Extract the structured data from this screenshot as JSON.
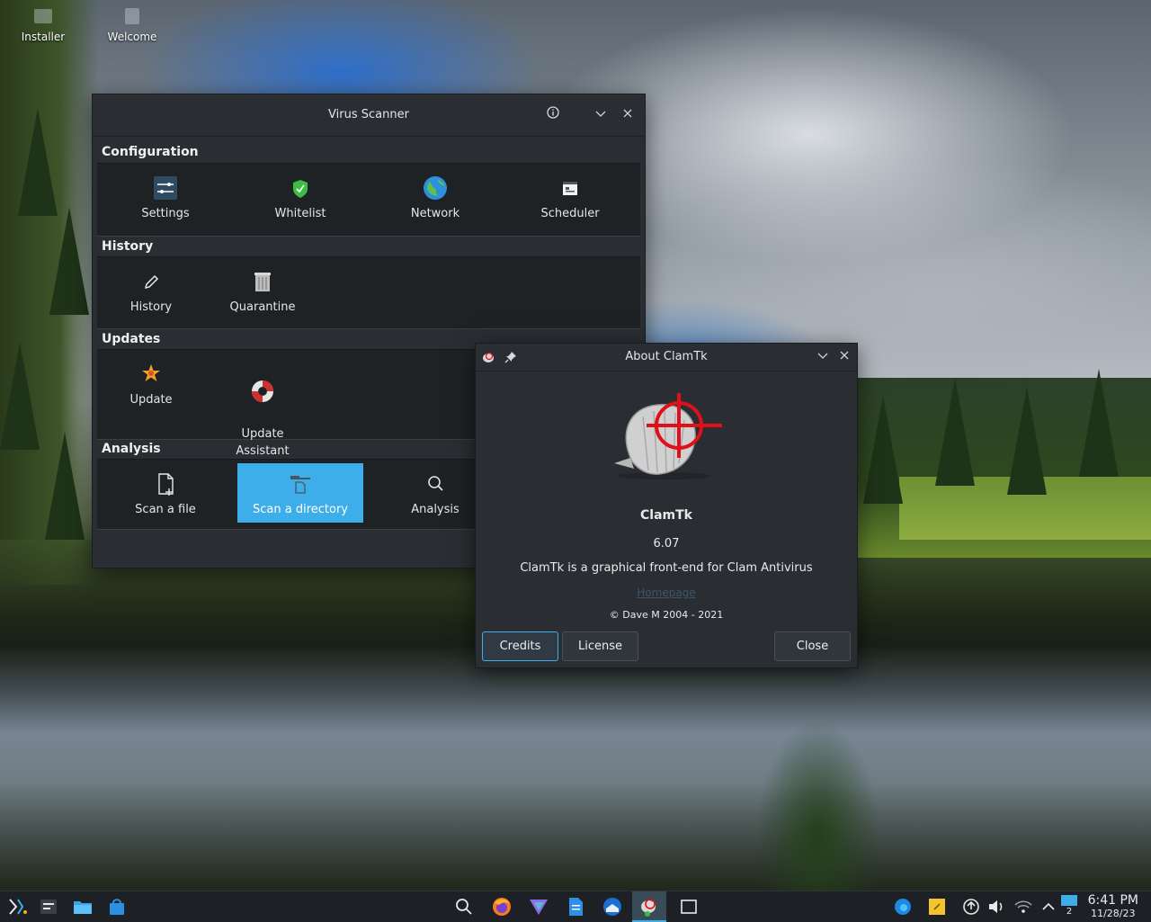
{
  "desktop": {
    "icons": [
      {
        "label": "Installer",
        "icon": "installer-icon"
      },
      {
        "label": "Welcome",
        "icon": "welcome-icon"
      }
    ]
  },
  "virus_scanner": {
    "title": "Virus Scanner",
    "sections": {
      "configuration": {
        "label": "Configuration",
        "items": [
          "Settings",
          "Whitelist",
          "Network",
          "Scheduler"
        ]
      },
      "history": {
        "label": "History",
        "items": [
          "History",
          "Quarantine"
        ]
      },
      "updates": {
        "label": "Updates",
        "items": [
          "Update",
          "Update\nAssistant"
        ]
      },
      "analysis": {
        "label": "Analysis",
        "items": [
          "Scan a file",
          "Scan a directory",
          "Analysis"
        ]
      }
    },
    "selected_item": "Scan a directory"
  },
  "about": {
    "title": "About ClamTk",
    "app_name": "ClamTk",
    "version": "6.07",
    "description": "ClamTk is a graphical front-end for Clam Antivirus",
    "homepage_link": "Homepage",
    "copyright": "© Dave M 2004 - 2021",
    "buttons": {
      "credits": "Credits",
      "license": "License",
      "close": "Close"
    }
  },
  "taskbar": {
    "time": "6:41 PM",
    "date": "11/28/23",
    "pager_number": "2"
  },
  "colors": {
    "accent": "#3daee9",
    "window_bg": "#2a2e32",
    "panel_bg": "#1f2225",
    "target_red": "#e0101a"
  }
}
